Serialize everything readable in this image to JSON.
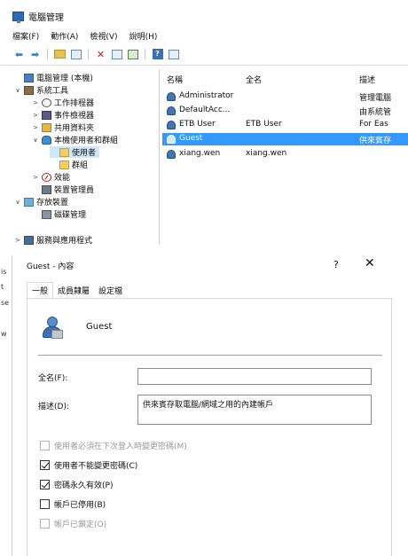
{
  "cm": {
    "title": "電腦管理",
    "menu": [
      "檔案(F)",
      "動作(A)",
      "檢視(V)",
      "說明(H)"
    ],
    "tree": [
      {
        "label": "電腦管理 (本機)",
        "icon": "computer-icon",
        "twisty": ""
      },
      {
        "label": "系統工具",
        "icon": "tools-icon",
        "twisty": "∨"
      },
      {
        "label": "工作排程器",
        "icon": "clock-icon",
        "twisty": ">"
      },
      {
        "label": "事件檢視器",
        "icon": "event-viewer-icon",
        "twisty": ">"
      },
      {
        "label": "共用資料夾",
        "icon": "shared-folder-icon",
        "twisty": ">"
      },
      {
        "label": "本機使用者和群組",
        "icon": "users-icon",
        "twisty": "∨"
      },
      {
        "label": "使用者",
        "icon": "folder-icon",
        "twisty": ""
      },
      {
        "label": "群組",
        "icon": "folder-icon",
        "twisty": ""
      },
      {
        "label": "效能",
        "icon": "performance-icon",
        "twisty": ">"
      },
      {
        "label": "裝置管理員",
        "icon": "device-manager-icon",
        "twisty": ""
      },
      {
        "label": "存放裝置",
        "icon": "storage-icon",
        "twisty": "∨"
      },
      {
        "label": "磁碟管理",
        "icon": "disk-icon",
        "twisty": ""
      },
      {
        "label": "服務與應用程式",
        "icon": "services-icon",
        "twisty": ">"
      }
    ],
    "columns": {
      "name": "名稱",
      "fullname": "全名",
      "desc": "描述"
    },
    "users": [
      {
        "name": "Administrator",
        "fullname": "",
        "desc": "管理電腦"
      },
      {
        "name": "DefaultAcc...",
        "fullname": "",
        "desc": "由系統管"
      },
      {
        "name": "ETB User",
        "fullname": "ETB User",
        "desc": "For Eas"
      },
      {
        "name": "Guest",
        "fullname": "",
        "desc": "供來賓存"
      },
      {
        "name": "xiang.wen",
        "fullname": "xiang.wen",
        "desc": ""
      }
    ]
  },
  "dialog": {
    "title": "Guest - 內容",
    "help": "?",
    "close": "✕",
    "tabs": [
      "一般",
      "成員隸屬",
      "設定檔"
    ],
    "username": "Guest",
    "fullname_label": "全名(F):",
    "fullname_value": "",
    "desc_label": "描述(D):",
    "desc_value": "供來賓存取電腦/網域之用的內建帳戶",
    "checkboxes": [
      {
        "label": "使用者必須在下次登入時變更密碼(M)",
        "checked": false,
        "disabled": true
      },
      {
        "label": "使用者不能變更密碼(C)",
        "checked": true,
        "disabled": false
      },
      {
        "label": "密碼永久有效(P)",
        "checked": true,
        "disabled": false
      },
      {
        "label": "帳戶已停用(B)",
        "checked": false,
        "disabled": false
      },
      {
        "label": "帳戶已鎖定(O)",
        "checked": false,
        "disabled": true
      }
    ],
    "edge_fragments": [
      "is",
      "t",
      "se",
      "w"
    ]
  }
}
